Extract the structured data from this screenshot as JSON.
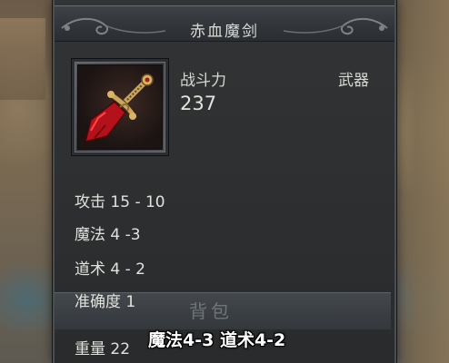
{
  "item": {
    "name": "赤血魔剑",
    "power_label": "战斗力",
    "power_value": "237",
    "type": "武器"
  },
  "stats": [
    {
      "text": "攻击 15 - 10"
    },
    {
      "text": "魔法 4 -3"
    },
    {
      "text": "道术 4 - 2"
    },
    {
      "text": "准确度 1"
    },
    {
      "text": "重量 22"
    }
  ],
  "bag_label": "背包",
  "subtitle": "魔法4-3 道术4-2",
  "icons": {
    "item": "red-sword-icon",
    "ornament": "scroll-ornament-icon"
  },
  "colors": {
    "panel_bg": "#2b2d2f",
    "text": "#e2e2dc",
    "sword_blade": "#b3121b"
  }
}
